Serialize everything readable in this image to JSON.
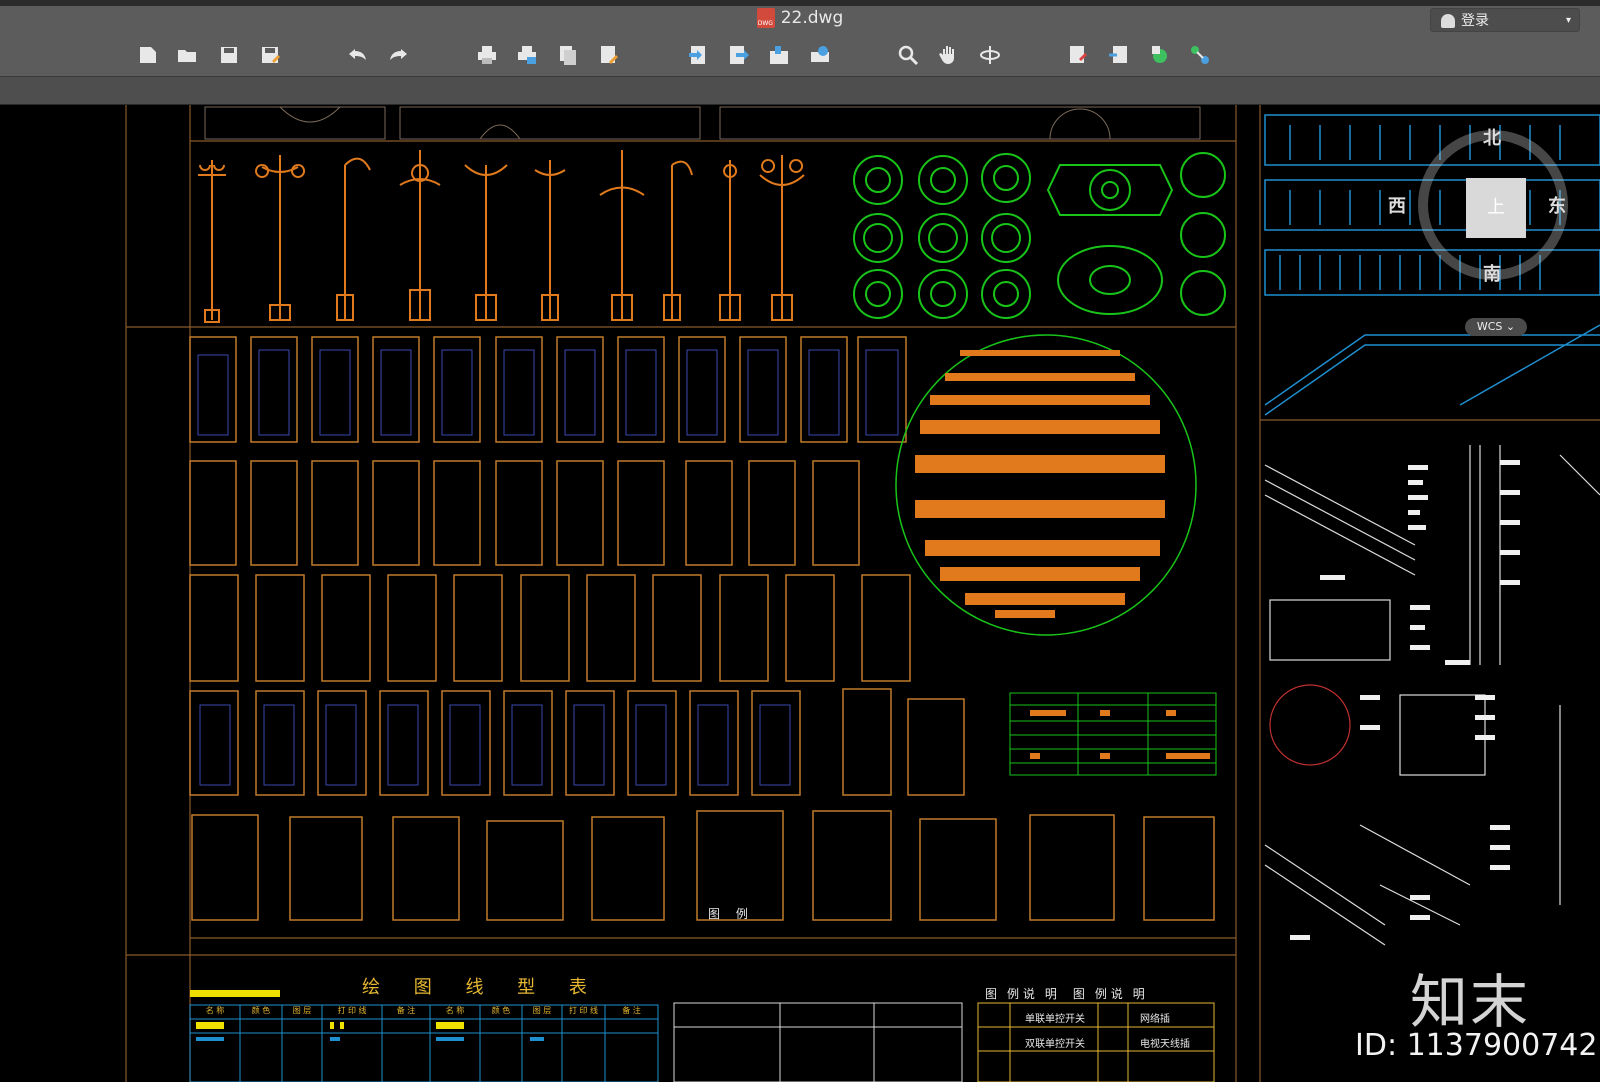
{
  "window": {
    "title": "22.dwg",
    "file_icon_label": "DWG",
    "login_label": "登录"
  },
  "toolbar": {
    "icons": [
      "new-file-icon",
      "open-folder-icon",
      "save-icon",
      "save-as-icon",
      "undo-icon",
      "redo-icon",
      "print-icon",
      "print-preview-icon",
      "batch-print-icon",
      "publish-icon",
      "import-icon",
      "export-icon",
      "attach-icon",
      "plot-icon",
      "zoom-icon",
      "pan-icon",
      "orbit-icon",
      "layer-icon",
      "block-icon",
      "external-ref-icon",
      "properties-icon"
    ]
  },
  "viewcube": {
    "north": "北",
    "south": "南",
    "east": "东",
    "west": "西",
    "top": "上",
    "coordinate_system": "WCS"
  },
  "drawing": {
    "line_type_table_title": "绘 图 线 型 表",
    "legend_title": "图 例",
    "legend_header": [
      "图",
      "例 说",
      "明",
      "图",
      "例 说",
      "明"
    ],
    "legend_rows": [
      [
        "单联单控开关",
        "网络插"
      ],
      [
        "双联单控开关",
        "电视天线插"
      ]
    ],
    "line_table_header": [
      "名 称",
      "颜 色",
      "图 层",
      "打 印 线",
      "备 注",
      "名 称",
      "颜 色",
      "图 层",
      "打 印 线",
      "备 注"
    ]
  },
  "watermark": {
    "logo": "知末",
    "id": "ID: 1137900742"
  },
  "colors": {
    "orange": "#e07a1c",
    "green": "#19c419",
    "blue": "#2e8fd0",
    "yellow": "#f0e000",
    "frame": "#8a5a2a"
  }
}
